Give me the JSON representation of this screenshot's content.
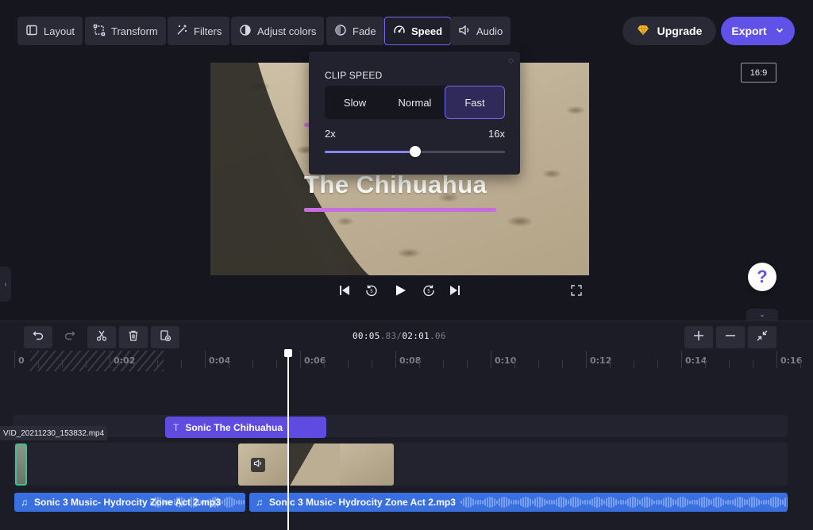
{
  "toolbar": {
    "layout": "Layout",
    "transform": "Transform",
    "filters": "Filters",
    "adjust_colors": "Adjust colors",
    "fade": "Fade",
    "speed": "Speed",
    "audio": "Audio",
    "upgrade": "Upgrade",
    "export": "Export"
  },
  "preview": {
    "aspect_ratio": "16:9",
    "title_text": "The Chihuahua"
  },
  "speed_panel": {
    "title": "CLIP SPEED",
    "options": [
      "Slow",
      "Normal",
      "Fast"
    ],
    "selected": "Fast",
    "range_min_label": "2x",
    "range_max_label": "16x",
    "slider_fraction": 0.5
  },
  "playback": {
    "help_label": "?"
  },
  "timeline": {
    "timecode_current_main": "00:05",
    "timecode_current_frac": ".83",
    "timecode_sep": "/",
    "timecode_total_main": "02:01",
    "timecode_total_frac": ".06",
    "ruler_labels": [
      "0",
      "0:02",
      "0:04",
      "0:06",
      "0:08",
      "0:10",
      "0:12",
      "0:14",
      "0:16"
    ],
    "text_clip_label": "Sonic The Chihuahua",
    "video_file_label": "VID_20211230_153832.mp4",
    "audio_clip_1": "Sonic 3 Music- Hydrocity Zone Act 2.mp3",
    "audio_clip_2": "Sonic 3 Music- Hydrocity Zone Act 2.mp3"
  },
  "colors": {
    "accent": "#6052e8",
    "selected_outline": "#6f6af0",
    "title_underline": "#c66fdc",
    "audio_clip": "#3a6fe0",
    "clip_selected_border": "#39c48d"
  }
}
